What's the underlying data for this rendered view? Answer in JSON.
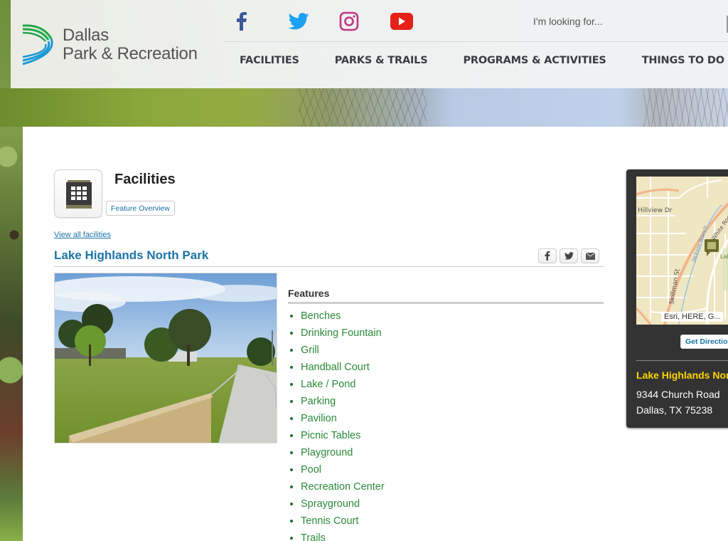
{
  "site": {
    "logo_line1": "Dallas",
    "logo_line2": "Park & Recreation",
    "logo_colors": {
      "green": "#1fa84a",
      "blue": "#1d9ad6"
    }
  },
  "social": [
    {
      "name": "facebook-icon",
      "color": "#3b5998"
    },
    {
      "name": "twitter-icon",
      "color": "#1da1f2"
    },
    {
      "name": "instagram-icon",
      "color": "#c13584"
    },
    {
      "name": "youtube-icon",
      "color": "#e62117"
    }
  ],
  "search": {
    "placeholder": "I'm looking for..."
  },
  "nav": {
    "items": [
      "FACILITIES",
      "PARKS & TRAILS",
      "PROGRAMS & ACTIVITIES",
      "THINGS TO DO"
    ]
  },
  "section": {
    "title": "Facilities",
    "feature_overview_label": "Feature Overview",
    "view_all_label": "View all facilities",
    "icon": "building-icon"
  },
  "park": {
    "name": "Lake Highlands North Park",
    "share": [
      "facebook-share-icon",
      "twitter-share-icon",
      "email-share-icon"
    ],
    "photo_alt": "Park walkway with stone wall and lawn"
  },
  "features": {
    "heading": "Features",
    "items": [
      "Benches",
      "Drinking Fountain",
      "Grill",
      "Handball Court",
      "Lake / Pond",
      "Parking",
      "Pavilion",
      "Picnic Tables",
      "Playground",
      "Pool",
      "Recreation Center",
      "Sprayground",
      "Tennis Court",
      "Trails"
    ]
  },
  "map": {
    "labels": {
      "street1": "Hillview Dr",
      "street2": "Skillman St",
      "street3": "White Rock Trl",
      "creek": "Jackson Branch",
      "park": "Lake Highlands North",
      "dr": "Dr"
    },
    "attribution": "Esri, HERE, G...",
    "directions_label": "Get Directions",
    "location_name": "Lake Highlands North Park",
    "address_line1": "9344 Church Road",
    "address_line2": "Dallas, TX 75238"
  }
}
